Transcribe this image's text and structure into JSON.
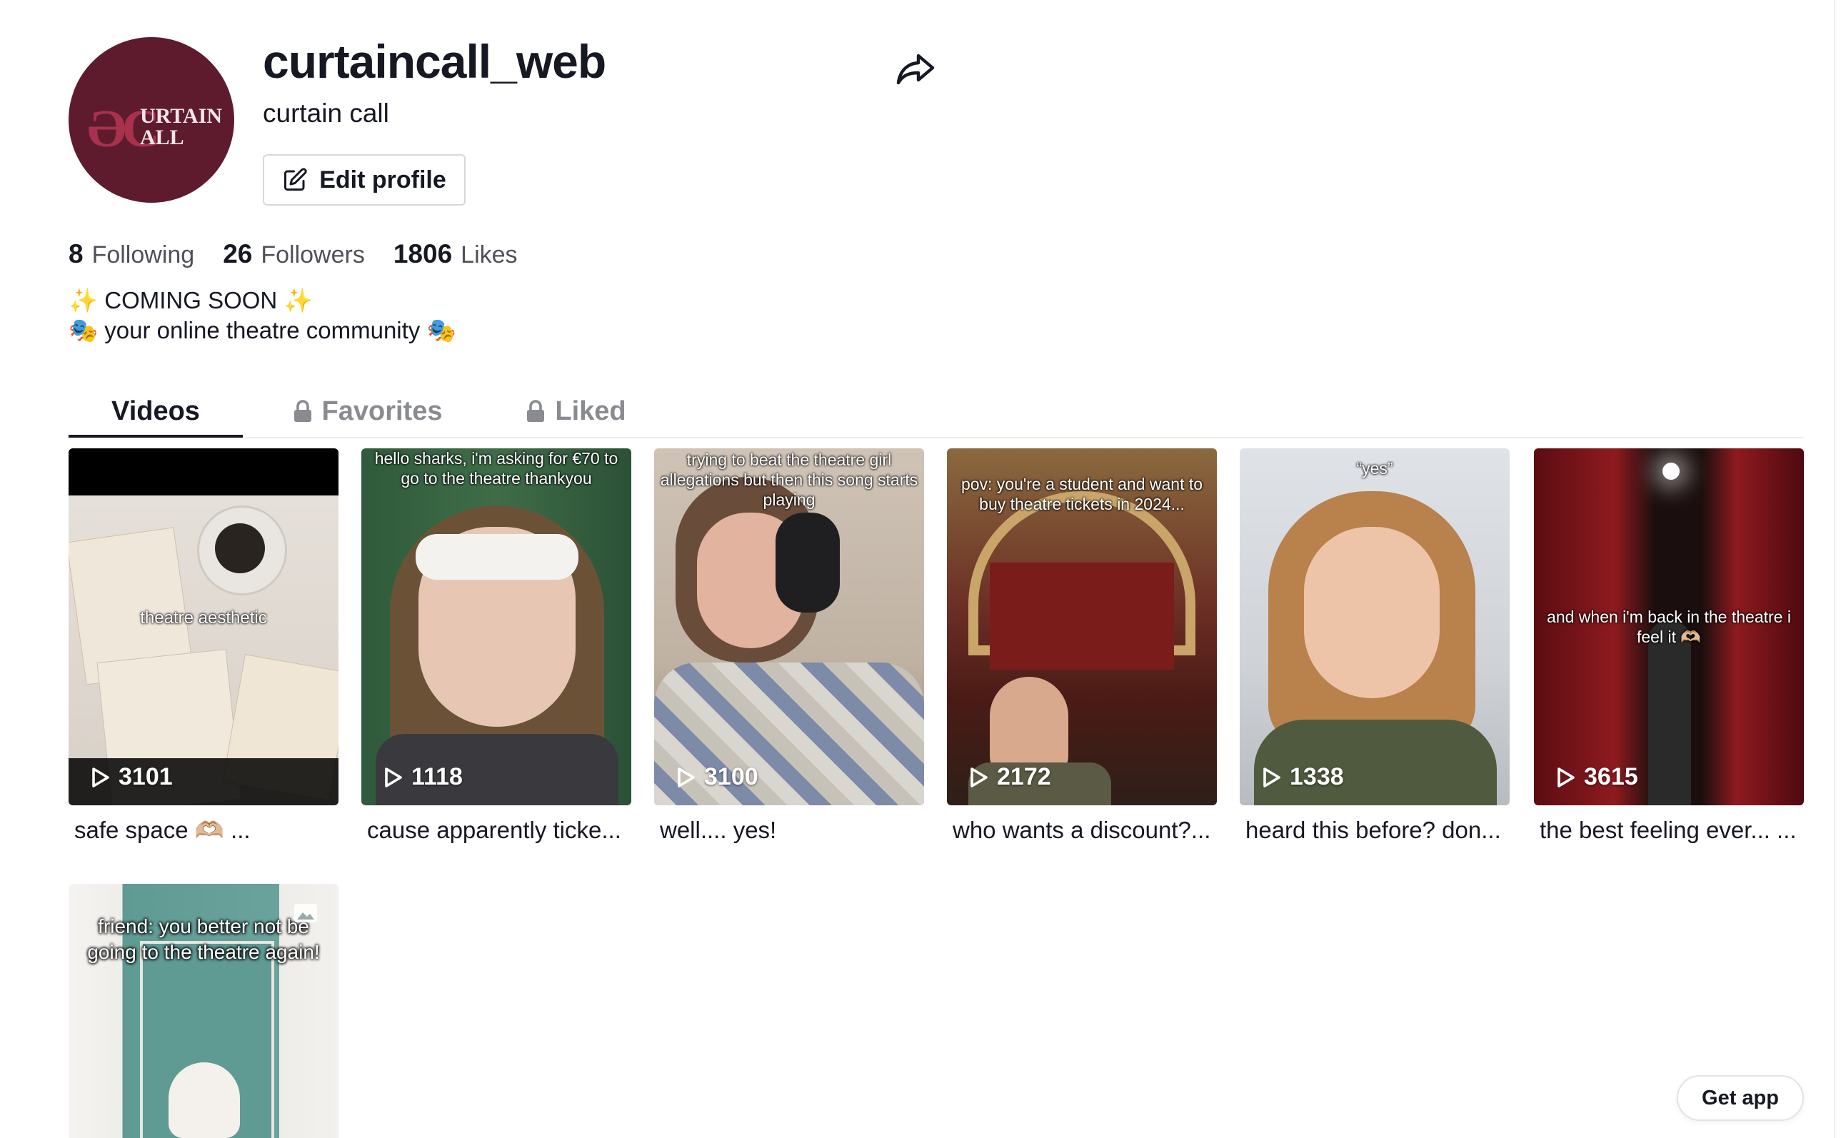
{
  "profile": {
    "username": "curtaincall_web",
    "nickname": "curtain call",
    "avatar_text_big": "ƏC",
    "edit_profile_label": "Edit profile"
  },
  "stats": {
    "following_count": "8",
    "following_label": "Following",
    "followers_count": "26",
    "followers_label": "Followers",
    "likes_count": "1806",
    "likes_label": "Likes"
  },
  "bio": {
    "line1": "✨ COMING SOON ✨",
    "line2": "🎭 your online theatre community 🎭"
  },
  "tabs": [
    {
      "label": "Videos",
      "active": true,
      "locked": false
    },
    {
      "label": "Favorites",
      "active": false,
      "locked": true
    },
    {
      "label": "Liked",
      "active": false,
      "locked": true
    }
  ],
  "videos": [
    {
      "overlay": "theatre aesthetic",
      "views": "3101",
      "caption": "safe space 🫶🏼 ..."
    },
    {
      "overlay": "hello sharks, i'm asking for €70 to go to the theatre thankyou",
      "views": "1118",
      "caption": "cause apparently ticke..."
    },
    {
      "overlay": "trying to beat the theatre girl allegations but then this song starts playing",
      "views": "3100",
      "caption": "well.... yes!"
    },
    {
      "overlay": "pov: you're a student and want to buy theatre tickets in 2024...",
      "views": "2172",
      "caption": "who wants a discount?..."
    },
    {
      "overlay": "“yes”",
      "views": "1338",
      "caption": "heard this before? don..."
    },
    {
      "overlay": "and when i'm back in the theatre i feel it 🫶🏼",
      "views": "3615",
      "caption": "the best feeling ever... ..."
    },
    {
      "overlay": "friend: you better not be going to the theatre again!",
      "views": "",
      "caption": ""
    }
  ],
  "get_app_label": "Get app",
  "colors": {
    "avatar_bg": "#5e1b2e",
    "text": "#161823",
    "muted": "#8a8b91"
  }
}
